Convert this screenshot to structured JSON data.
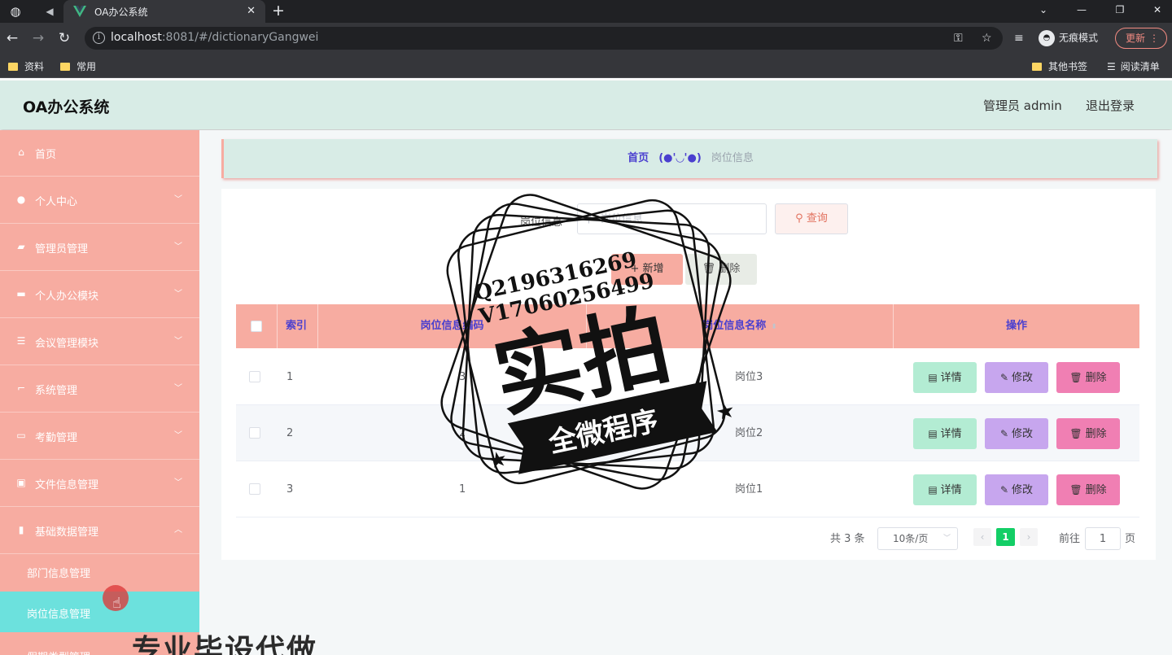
{
  "browser": {
    "tab_title": "OA办公系统",
    "url_host": "localhost",
    "url_rest": ":8081/#/dictionaryGangwei",
    "incognito_label": "无痕模式",
    "update_label": "更新",
    "bookmarks": [
      "资料",
      "常用"
    ],
    "bookmarks_right": [
      "其他书签",
      "阅读清单"
    ]
  },
  "header": {
    "title": "OA办公系统",
    "user": "管理员 admin",
    "logout": "退出登录"
  },
  "sidebar": {
    "items": [
      {
        "label": "首页",
        "icon": "home-icon",
        "expandable": false
      },
      {
        "label": "个人中心",
        "icon": "user-icon",
        "expandable": true
      },
      {
        "label": "管理员管理",
        "icon": "wallet-icon",
        "expandable": true
      },
      {
        "label": "个人办公模块",
        "icon": "briefcase-icon",
        "expandable": true
      },
      {
        "label": "会议管理模块",
        "icon": "sliders-icon",
        "expandable": true
      },
      {
        "label": "系统管理",
        "icon": "crop-icon",
        "expandable": true
      },
      {
        "label": "考勤管理",
        "icon": "card-icon",
        "expandable": true
      },
      {
        "label": "文件信息管理",
        "icon": "picture-icon",
        "expandable": true
      },
      {
        "label": "基础数据管理",
        "icon": "bar-chart-icon",
        "expandable": true,
        "expanded": true
      }
    ],
    "sub_items": [
      {
        "label": "部门信息管理",
        "active": false
      },
      {
        "label": "岗位信息管理",
        "active": true
      },
      {
        "label": "假期类型管理",
        "active": false
      }
    ]
  },
  "breadcrumb": {
    "home": "首页",
    "separator": "(●'◡'●)",
    "current": "岗位信息"
  },
  "search": {
    "label": "岗位信息",
    "placeholder": "岗位信息",
    "button": "查询"
  },
  "actions": {
    "add": "新增",
    "delete": "删除"
  },
  "table": {
    "columns": [
      "索引",
      "岗位信息编码",
      "岗位信息名称",
      "操作"
    ],
    "rows": [
      {
        "index": "1",
        "code": "3",
        "name": "岗位3"
      },
      {
        "index": "2",
        "code": "2",
        "name": "岗位2"
      },
      {
        "index": "3",
        "code": "1",
        "name": "岗位1"
      }
    ],
    "row_actions": {
      "detail": "详情",
      "edit": "修改",
      "delete": "删除"
    }
  },
  "pagination": {
    "total": "共 3 条",
    "page_size": "10条/页",
    "current_page": "1",
    "goto_label": "前往",
    "goto_value": "1",
    "page_unit": "页"
  },
  "watermark": {
    "contact_line1": "Q2196316269",
    "contact_line2": "V17060256499",
    "big_text": "实拍",
    "banner_text": "全微程序",
    "bottom_text": "专业毕设代做"
  },
  "colors": {
    "sidebar": "#f7aca1",
    "header": "#d8ece6",
    "active_sub": "#6ce1dd",
    "accent_text": "#4a3fcf",
    "detail_btn": "#b3ecd3",
    "edit_btn": "#c7a6ee",
    "delete_btn": "#f07fb3",
    "page_active": "#13ce66"
  }
}
